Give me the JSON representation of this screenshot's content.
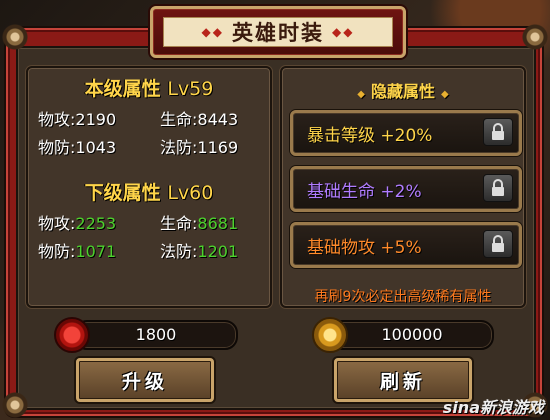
{
  "title": "英雄时装",
  "current_level": {
    "heading": "本级属性",
    "level": "Lv59",
    "stats": [
      {
        "label": "物攻:",
        "value": "2190"
      },
      {
        "label": "生命:",
        "value": "8443"
      },
      {
        "label": "物防:",
        "value": "1043"
      },
      {
        "label": "法防:",
        "value": "1169"
      }
    ]
  },
  "next_level": {
    "heading": "下级属性",
    "level": "Lv60",
    "stats": [
      {
        "label": "物攻:",
        "value": "2253"
      },
      {
        "label": "生命:",
        "value": "8681"
      },
      {
        "label": "物防:",
        "value": "1071"
      },
      {
        "label": "法防:",
        "value": "1201"
      }
    ]
  },
  "hidden": {
    "heading": "隐藏属性",
    "attributes": [
      {
        "label": "暴击等级 +20%",
        "color": "#ffd54a",
        "icon": "lock-icon"
      },
      {
        "label": "基础生命 +2%",
        "color": "#b07cff",
        "icon": "lock-icon"
      },
      {
        "label": "基础物攻 +5%",
        "color": "#ff8a2a",
        "icon": "lock-icon"
      }
    ],
    "refresh_note": "再刷9次必定出高级稀有属性"
  },
  "costs": {
    "upgrade_cost": "1800",
    "refresh_cost": "100000"
  },
  "buttons": {
    "upgrade": "升级",
    "refresh": "刷新"
  },
  "watermark": "sina新浪游戏"
}
